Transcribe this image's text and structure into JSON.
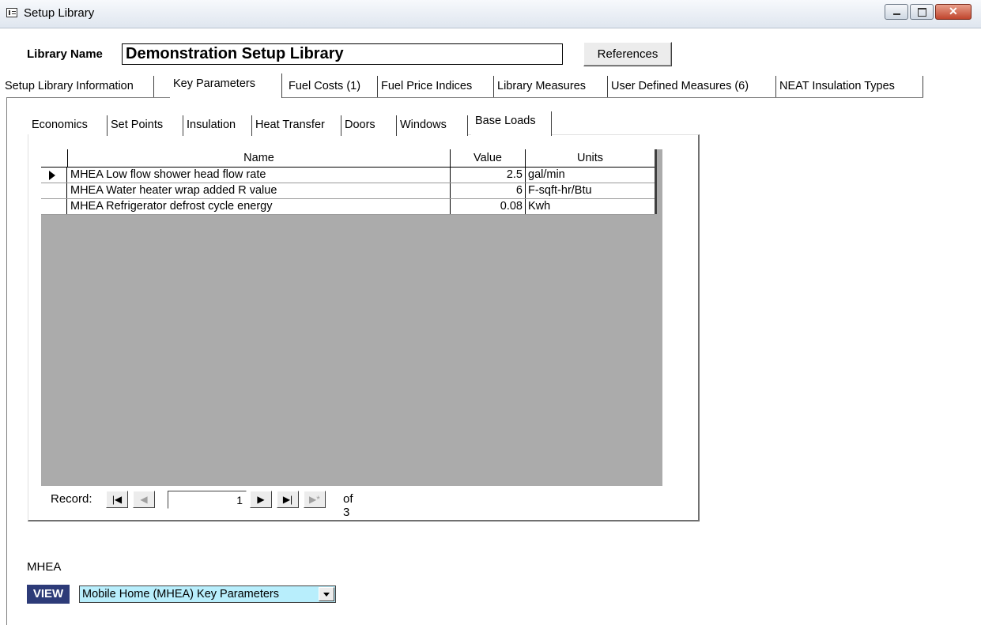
{
  "window": {
    "title": "Setup Library"
  },
  "library": {
    "label": "Library Name",
    "value": "Demonstration Setup Library",
    "references_button": "References"
  },
  "outer_tabs": [
    {
      "label": "Setup Library Information"
    },
    {
      "label": "Key Parameters"
    },
    {
      "label": "Fuel Costs (1)"
    },
    {
      "label": "Fuel Price Indices"
    },
    {
      "label": "Library Measures"
    },
    {
      "label": "User Defined Measures (6)"
    },
    {
      "label": "NEAT Insulation Types"
    }
  ],
  "inner_tabs": [
    {
      "label": "Economics"
    },
    {
      "label": "Set Points"
    },
    {
      "label": "Insulation"
    },
    {
      "label": "Heat Transfer"
    },
    {
      "label": "Doors"
    },
    {
      "label": "Windows"
    },
    {
      "label": "Base Loads"
    }
  ],
  "grid": {
    "columns": [
      "Name",
      "Value",
      "Units"
    ],
    "rows": [
      {
        "name": "MHEA Low flow shower head flow rate",
        "value": "2.5",
        "units": "gal/min"
      },
      {
        "name": "MHEA Water heater wrap added R value",
        "value": "6",
        "units": "F-sqft-hr/Btu"
      },
      {
        "name": "MHEA Refrigerator defrost cycle energy",
        "value": "0.08",
        "units": "Kwh"
      }
    ]
  },
  "navigator": {
    "label": "Record:",
    "current": "1",
    "of_text": "of 3"
  },
  "footer": {
    "group_label": "MHEA",
    "view_label": "VIEW",
    "view_value": "Mobile Home (MHEA) Key Parameters"
  }
}
